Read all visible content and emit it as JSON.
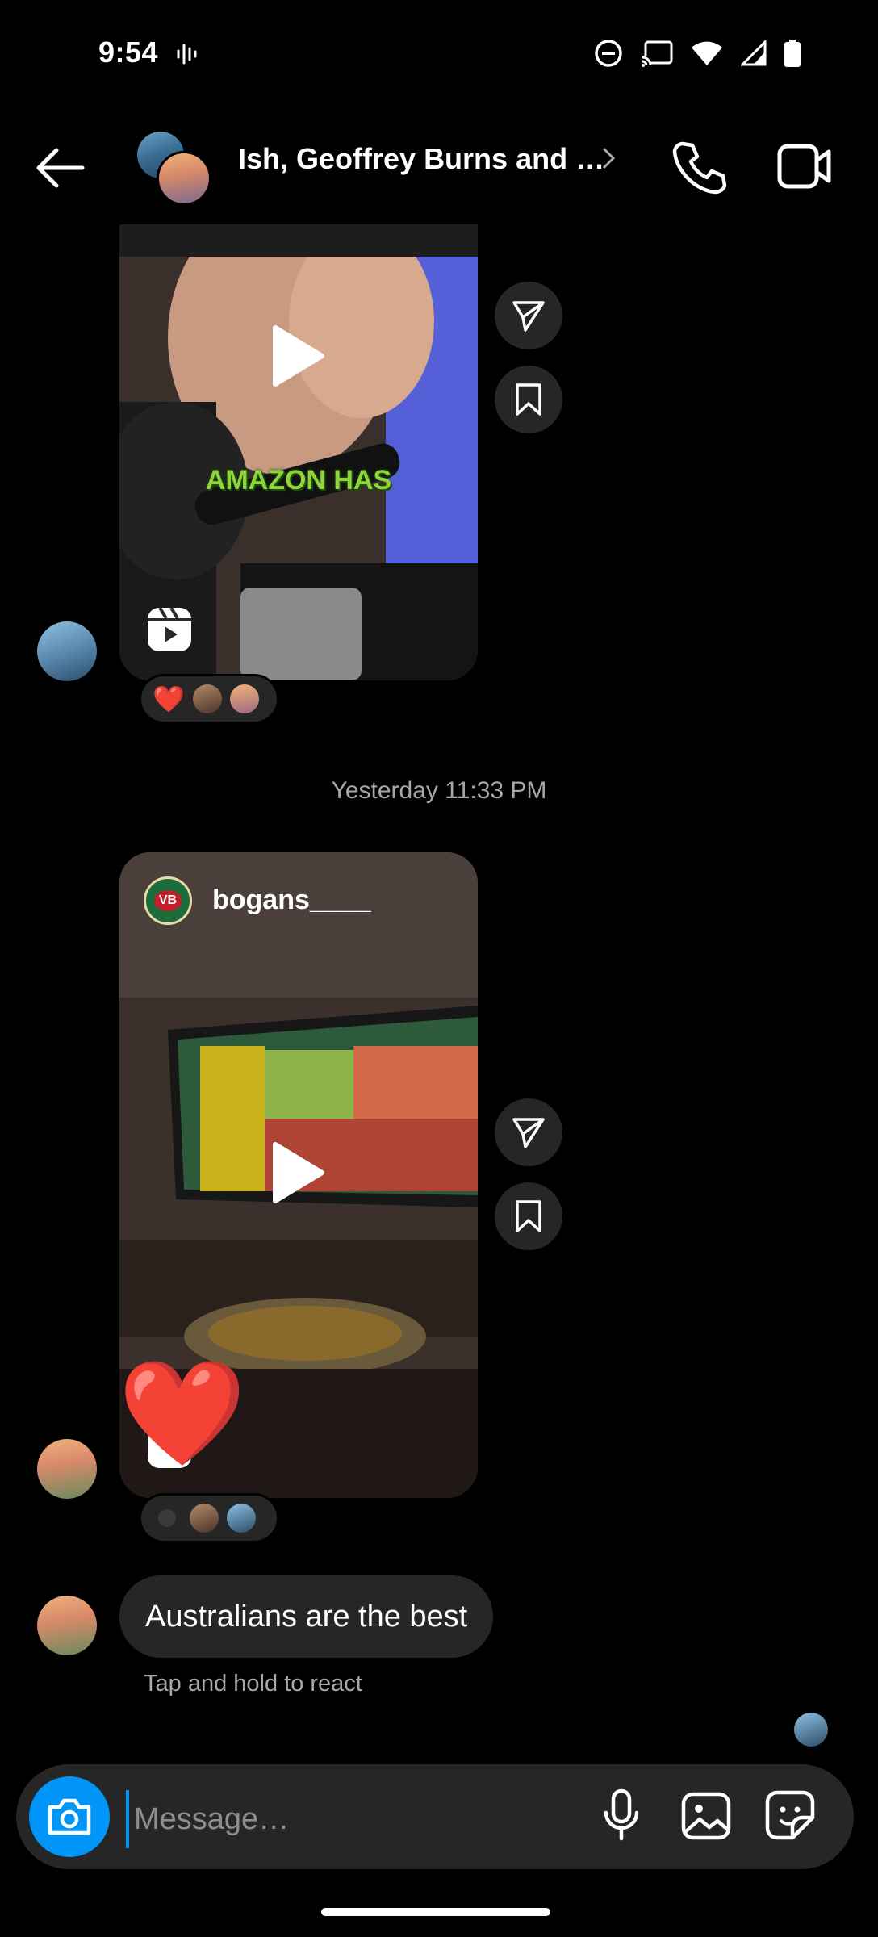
{
  "status_bar": {
    "time": "9:54"
  },
  "header": {
    "title": "Ish, Geoffrey Burns and …",
    "back_icon": "arrow-left-icon",
    "call_icon": "phone-icon",
    "video_icon": "video-camera-icon"
  },
  "messages": {
    "reel1": {
      "caption_text": "AMAZON HAS",
      "reactions": [
        "❤️"
      ]
    },
    "timestamp": "Yesterday 11:33 PM",
    "reel2": {
      "account": "bogans____",
      "logo_text": "VB",
      "big_reaction": "❤️"
    },
    "text_message": {
      "text": "Australians are the best",
      "hint": "Tap and hold to react"
    }
  },
  "composer": {
    "placeholder": "Message…"
  },
  "colors": {
    "accent": "#0095f6",
    "bubble": "#262626",
    "background": "#000000"
  }
}
